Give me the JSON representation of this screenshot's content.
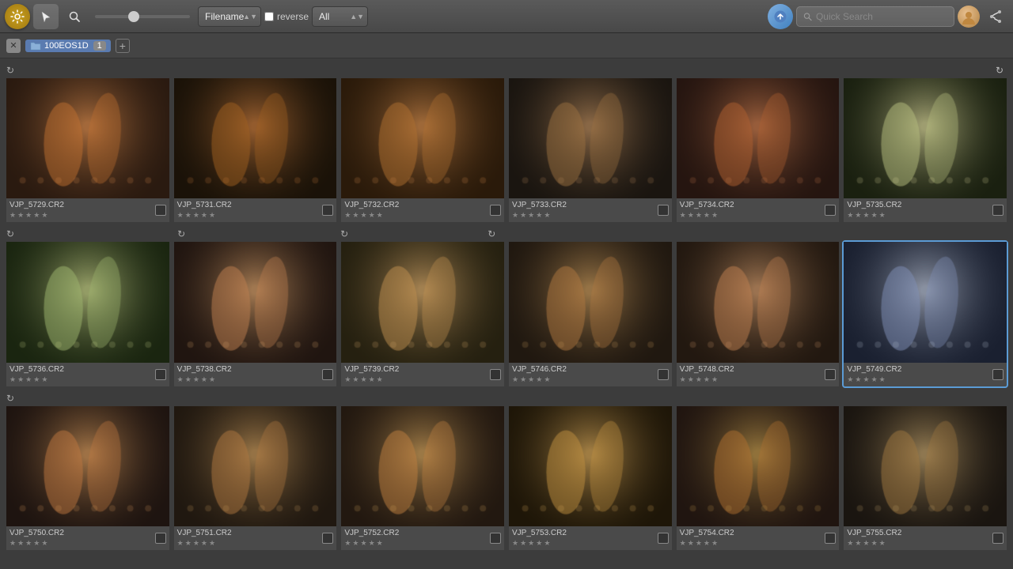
{
  "toolbar": {
    "sort_label": "Filename",
    "reverse_label": "reverse",
    "filter_label": "All",
    "search_placeholder": "Quick Search",
    "slider_value": 40
  },
  "breadcrumb": {
    "folder_name": "100EOS1D",
    "badge_count": "1"
  },
  "photos_row1": [
    {
      "id": "vjp5729",
      "name": "VJP_5729.CR2",
      "selected": false,
      "theme": "dance1"
    },
    {
      "id": "vjp5731",
      "name": "VJP_5731.CR2",
      "selected": false,
      "theme": "dance2"
    },
    {
      "id": "vjp5732",
      "name": "VJP_5732.CR2",
      "selected": false,
      "theme": "dance3"
    },
    {
      "id": "vjp5733",
      "name": "VJP_5733.CR2",
      "selected": false,
      "theme": "dance4"
    },
    {
      "id": "vjp5734",
      "name": "VJP_5734.CR2",
      "selected": false,
      "theme": "dance5"
    },
    {
      "id": "vjp5735",
      "name": "VJP_5735.CR2",
      "selected": false,
      "theme": "champagne1"
    }
  ],
  "photos_row2": [
    {
      "id": "vjp5736",
      "name": "VJP_5736.CR2",
      "selected": false,
      "theme": "champagne2"
    },
    {
      "id": "vjp5738",
      "name": "VJP_5738.CR2",
      "selected": false,
      "theme": "speech1"
    },
    {
      "id": "vjp5739",
      "name": "VJP_5739.CR2",
      "selected": false,
      "theme": "speech2"
    },
    {
      "id": "vjp5746",
      "name": "VJP_5746.CR2",
      "selected": false,
      "theme": "speech3"
    },
    {
      "id": "vjp5748",
      "name": "VJP_5748.CR2",
      "selected": false,
      "theme": "speech4"
    },
    {
      "id": "vjp5749",
      "name": "VJP_5749.CR2",
      "selected": true,
      "theme": "portrait1"
    }
  ],
  "photos_row3": [
    {
      "id": "vjp5750",
      "name": "VJP_5750.CR2",
      "selected": false,
      "theme": "speech5"
    },
    {
      "id": "vjp5751",
      "name": "VJP_5751.CR2",
      "selected": false,
      "theme": "crowd1"
    },
    {
      "id": "vjp5752",
      "name": "VJP_5752.CR2",
      "selected": false,
      "theme": "crowd2"
    },
    {
      "id": "vjp5753",
      "name": "VJP_5753.CR2",
      "selected": false,
      "theme": "crowd3"
    },
    {
      "id": "vjp5754",
      "name": "VJP_5754.CR2",
      "selected": false,
      "theme": "crowd4"
    },
    {
      "id": "vjp5755",
      "name": "VJP_5755.CR2",
      "selected": false,
      "theme": "crowd5"
    }
  ],
  "stars_count": 5,
  "icons": {
    "gear": "⚙",
    "cursor": "↖",
    "search": "🔍",
    "upload": "↑",
    "add": "+",
    "close": "✕",
    "rotate": "↻",
    "folder": "📁"
  }
}
